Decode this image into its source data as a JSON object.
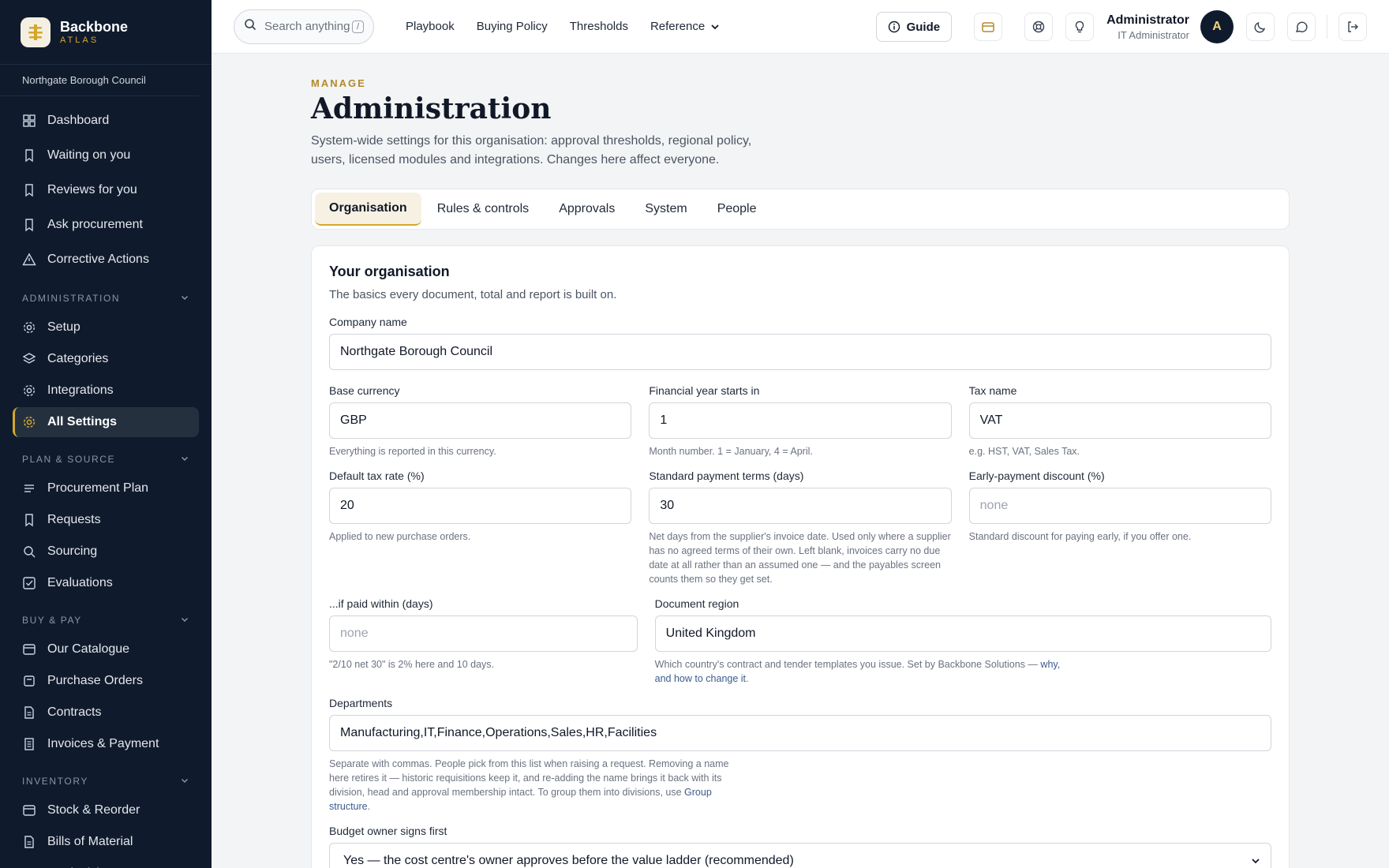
{
  "brand": {
    "name": "Backbone",
    "sub": "ATLAS",
    "accent": "#d4a72c"
  },
  "org_name": "Northgate Borough Council",
  "sidebar": {
    "top_items": [
      {
        "label": "Dashboard",
        "icon": "dashboard-icon"
      },
      {
        "label": "Waiting on you",
        "icon": "bookmark-icon"
      },
      {
        "label": "Reviews for you",
        "icon": "bookmark-icon"
      },
      {
        "label": "Ask procurement",
        "icon": "bookmark-icon"
      },
      {
        "label": "Corrective Actions",
        "icon": "warning-icon"
      }
    ],
    "sections": [
      {
        "title": "ADMINISTRATION",
        "items": [
          {
            "label": "Setup",
            "icon": "gear-icon"
          },
          {
            "label": "Categories",
            "icon": "layers-icon"
          },
          {
            "label": "Integrations",
            "icon": "gear-icon"
          },
          {
            "label": "All Settings",
            "icon": "gear-icon",
            "active": true
          }
        ]
      },
      {
        "title": "PLAN & SOURCE",
        "items": [
          {
            "label": "Procurement Plan",
            "icon": "list-icon"
          },
          {
            "label": "Requests",
            "icon": "bookmark-icon"
          },
          {
            "label": "Sourcing",
            "icon": "search-icon"
          },
          {
            "label": "Evaluations",
            "icon": "check-square-icon"
          }
        ]
      },
      {
        "title": "BUY & PAY",
        "items": [
          {
            "label": "Our Catalogue",
            "icon": "card-icon"
          },
          {
            "label": "Purchase Orders",
            "icon": "box-icon"
          },
          {
            "label": "Contracts",
            "icon": "document-icon"
          },
          {
            "label": "Invoices & Payment",
            "icon": "receipt-icon"
          }
        ]
      },
      {
        "title": "INVENTORY",
        "items": [
          {
            "label": "Stock & Reorder",
            "icon": "card-icon"
          },
          {
            "label": "Bills of Material",
            "icon": "document-icon"
          },
          {
            "label": "Replenishment Runs",
            "icon": "chart-icon"
          }
        ]
      }
    ]
  },
  "header": {
    "search_placeholder": "Search anything",
    "search_shortcut": "/",
    "nav": [
      "Playbook",
      "Buying Policy",
      "Thresholds",
      "Reference"
    ],
    "guide_label": "Guide",
    "user_name": "Administrator",
    "user_role": "IT Administrator",
    "avatar_initial": "A"
  },
  "page": {
    "eyebrow": "MANAGE",
    "title": "Administration",
    "description": "System-wide settings for this organisation: approval thresholds, regional policy, users, licensed modules and integrations. Changes here affect everyone."
  },
  "tabs": [
    "Organisation",
    "Rules & controls",
    "Approvals",
    "System",
    "People"
  ],
  "form": {
    "title": "Your organisation",
    "description": "The basics every document, total and report is built on.",
    "company_name": {
      "label": "Company name",
      "value": "Northgate Borough Council"
    },
    "base_currency": {
      "label": "Base currency",
      "value": "GBP",
      "help": "Everything is reported in this currency."
    },
    "fy_start": {
      "label": "Financial year starts in",
      "value": "1",
      "help": "Month number. 1 = January, 4 = April."
    },
    "tax_name": {
      "label": "Tax name",
      "value": "VAT",
      "help": "e.g. HST, VAT, Sales Tax."
    },
    "tax_rate": {
      "label": "Default tax rate (%)",
      "value": "20",
      "help": "Applied to new purchase orders."
    },
    "payment_terms": {
      "label": "Standard payment terms (days)",
      "value": "30",
      "help": "Net days from the supplier's invoice date. Used only where a supplier has no agreed terms of their own. Left blank, invoices carry no due date at all rather than an assumed one — and the payables screen counts them so they get set."
    },
    "early_discount": {
      "label": "Early-payment discount (%)",
      "placeholder": "none",
      "help": "Standard discount for paying early, if you offer one."
    },
    "paid_within": {
      "label": "...if paid within (days)",
      "placeholder": "none",
      "help": "\"2/10 net 30\" is 2% here and 10 days."
    },
    "doc_region": {
      "label": "Document region",
      "value": "United Kingdom",
      "help": "Which country's contract and tender templates you issue. Set by Backbone Solutions — ",
      "help_link": "why, and how to change it",
      "help_end": "."
    },
    "departments": {
      "label": "Departments",
      "value": "Manufacturing,IT,Finance,Operations,Sales,HR,Facilities",
      "help": "Separate with commas. People pick from this list when raising a request. Removing a name here retires it — historic requisitions keep it, and re-adding the name brings it back with its division, head and approval membership intact. To group them into divisions, use ",
      "help_link": "Group structure",
      "help_end": "."
    },
    "budget_owner": {
      "label": "Budget owner signs first",
      "value": "Yes — the cost centre's owner approves before the value ladder (recommended)"
    }
  }
}
